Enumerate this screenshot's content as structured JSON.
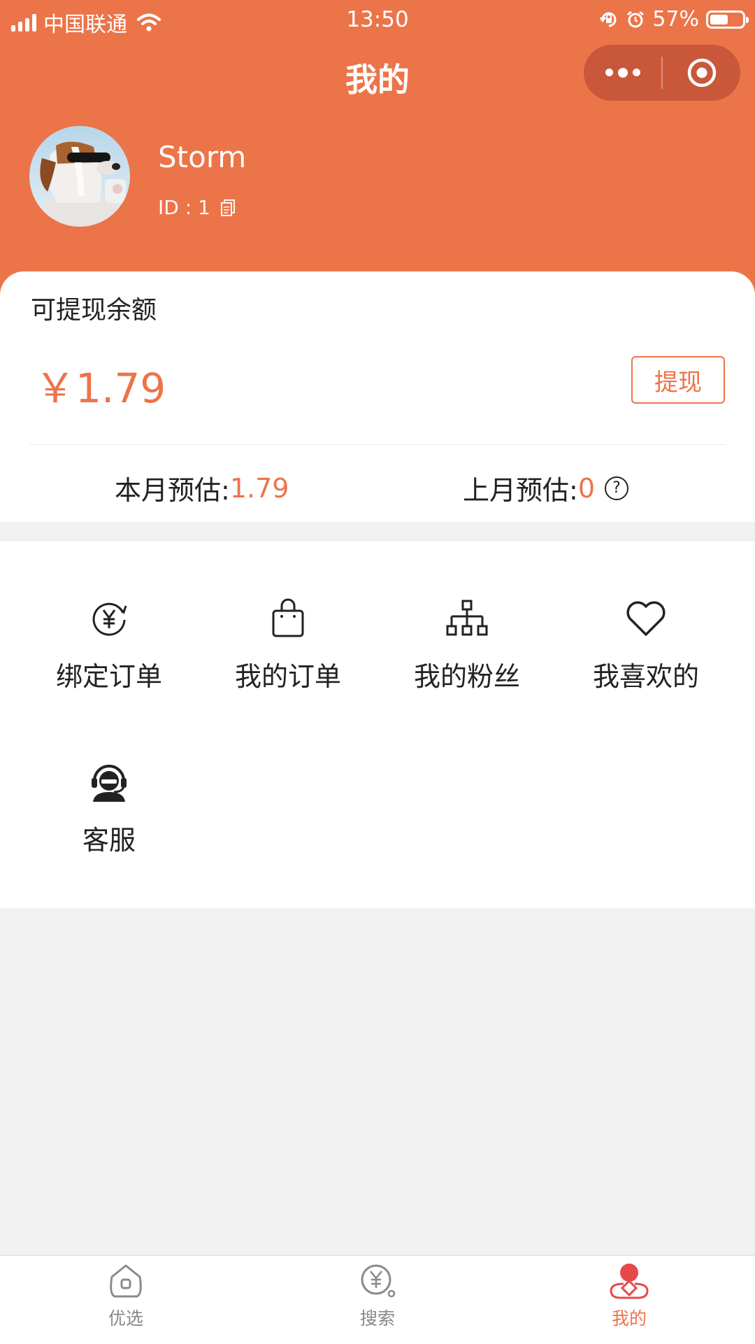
{
  "status_bar": {
    "carrier": "中国联通",
    "time": "13:50",
    "battery_percent": "57%",
    "battery_level": 0.57,
    "icons": [
      "signal-icon",
      "wifi-icon",
      "rotation-lock-icon",
      "alarm-icon",
      "battery-icon"
    ]
  },
  "nav": {
    "title": "我的",
    "capsule_icons": [
      "more-icon",
      "close-target-icon"
    ]
  },
  "profile": {
    "username": "Storm",
    "id_text": "ID : 1",
    "copy_icon": "copy-icon"
  },
  "balance": {
    "label": "可提现余额",
    "value": "￥1.79",
    "withdraw_label": "提现",
    "this_month_label": "本月预估:",
    "this_month_value": "1.79",
    "last_month_label": "上月预估:",
    "last_month_value": "0",
    "help_icon": "question-icon"
  },
  "menu": {
    "items": [
      {
        "label": "绑定订单",
        "icon": "yuan-refresh-icon"
      },
      {
        "label": "我的订单",
        "icon": "shopping-bag-icon"
      },
      {
        "label": "我的粉丝",
        "icon": "org-chart-icon"
      },
      {
        "label": "我喜欢的",
        "icon": "heart-icon"
      },
      {
        "label": "客服",
        "icon": "customer-service-icon"
      }
    ]
  },
  "tabbar": {
    "tabs": [
      {
        "label": "优选",
        "icon": "home-icon",
        "active": false
      },
      {
        "label": "搜索",
        "icon": "yuan-search-icon",
        "active": false
      },
      {
        "label": "我的",
        "icon": "profile-icon",
        "active": true
      }
    ]
  },
  "colors": {
    "accent": "#ec7449",
    "capsule": "#c9573a",
    "page_bg": "#f1f1f1"
  }
}
